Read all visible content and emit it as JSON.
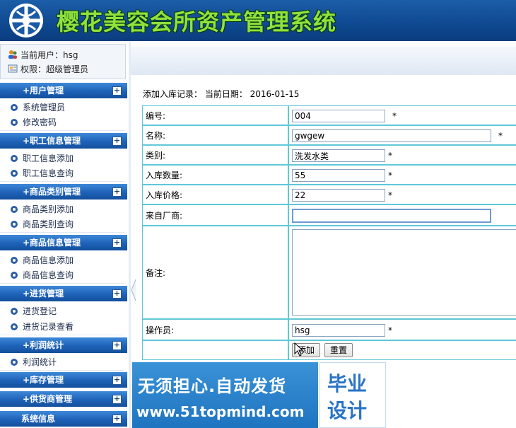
{
  "header": {
    "title": "樱花美容会所资产管理系统"
  },
  "user": {
    "current_user": "当前用户：hsg",
    "permission": "权限：超级管理员"
  },
  "sidebar": {
    "sections": [
      {
        "title": "+用户管理",
        "items": [
          "系统管理员",
          "修改密码"
        ]
      },
      {
        "title": "+职工信息管理",
        "items": [
          "职工信息添加",
          "职工信息查询"
        ]
      },
      {
        "title": "+商品类别管理",
        "items": [
          "商品类别添加",
          "商品类别查询"
        ]
      },
      {
        "title": "+商品信息管理",
        "items": [
          "商品信息添加",
          "商品信息查询"
        ]
      },
      {
        "title": "+进货管理",
        "items": [
          "进货登记",
          "进货记录查看"
        ]
      },
      {
        "title": "+利润统计",
        "items": [
          "利润统计"
        ]
      },
      {
        "title": "+库存管理",
        "items": []
      },
      {
        "title": "+供货商管理",
        "items": []
      },
      {
        "title": "系统信息",
        "items": []
      }
    ]
  },
  "main": {
    "breadcrumb": "添加入库记录：  当前日期：  2016-01-15",
    "fields": {
      "code": {
        "label": "编号:",
        "value": "004",
        "required": "*"
      },
      "name": {
        "label": "名称:",
        "value": "gwgew",
        "required": "*"
      },
      "category": {
        "label": "类别:",
        "value": "洗发水类",
        "required": "*"
      },
      "quantity": {
        "label": "入库数量:",
        "value": "55",
        "required": "*"
      },
      "price": {
        "label": "入库价格:",
        "value": "22",
        "required": "*"
      },
      "supplier": {
        "label": "来自厂商:",
        "value": ""
      },
      "remark": {
        "label": "备注:",
        "value": ""
      },
      "operator": {
        "label": "操作员:",
        "value": "hsg",
        "required": "*"
      }
    },
    "buttons": {
      "add": "添加",
      "reset": "重置"
    }
  },
  "ad": {
    "slogan": "无须担心.自动发货",
    "url": "www.51topmind.com",
    "badge_line1": "毕业",
    "badge_line2": "设计"
  },
  "colors": {
    "header_bg": "#1c5ea8",
    "title_green": "#8fe23c",
    "menu_blue": "#1e62b8",
    "table_border": "#5fc8d8"
  }
}
